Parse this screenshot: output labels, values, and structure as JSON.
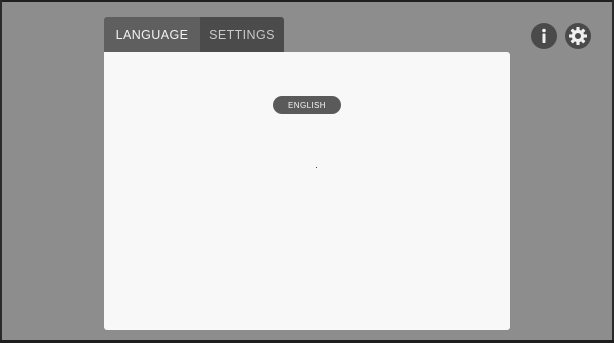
{
  "tabs": {
    "language_label": "LANGUAGE",
    "settings_label": "SETTINGS",
    "active": "LANGUAGE"
  },
  "panel": {
    "language_option": "ENGLISH"
  },
  "icons": {
    "info": "info-icon",
    "settings": "gear-icon"
  },
  "colors": {
    "background": "#8d8d8d",
    "panel": "#f8f8f8",
    "active_tab": "#5f5f5f",
    "inactive_tab": "#4b4b4b",
    "button": "#5a5a5a",
    "icon_circle": "#4a4a4a"
  }
}
